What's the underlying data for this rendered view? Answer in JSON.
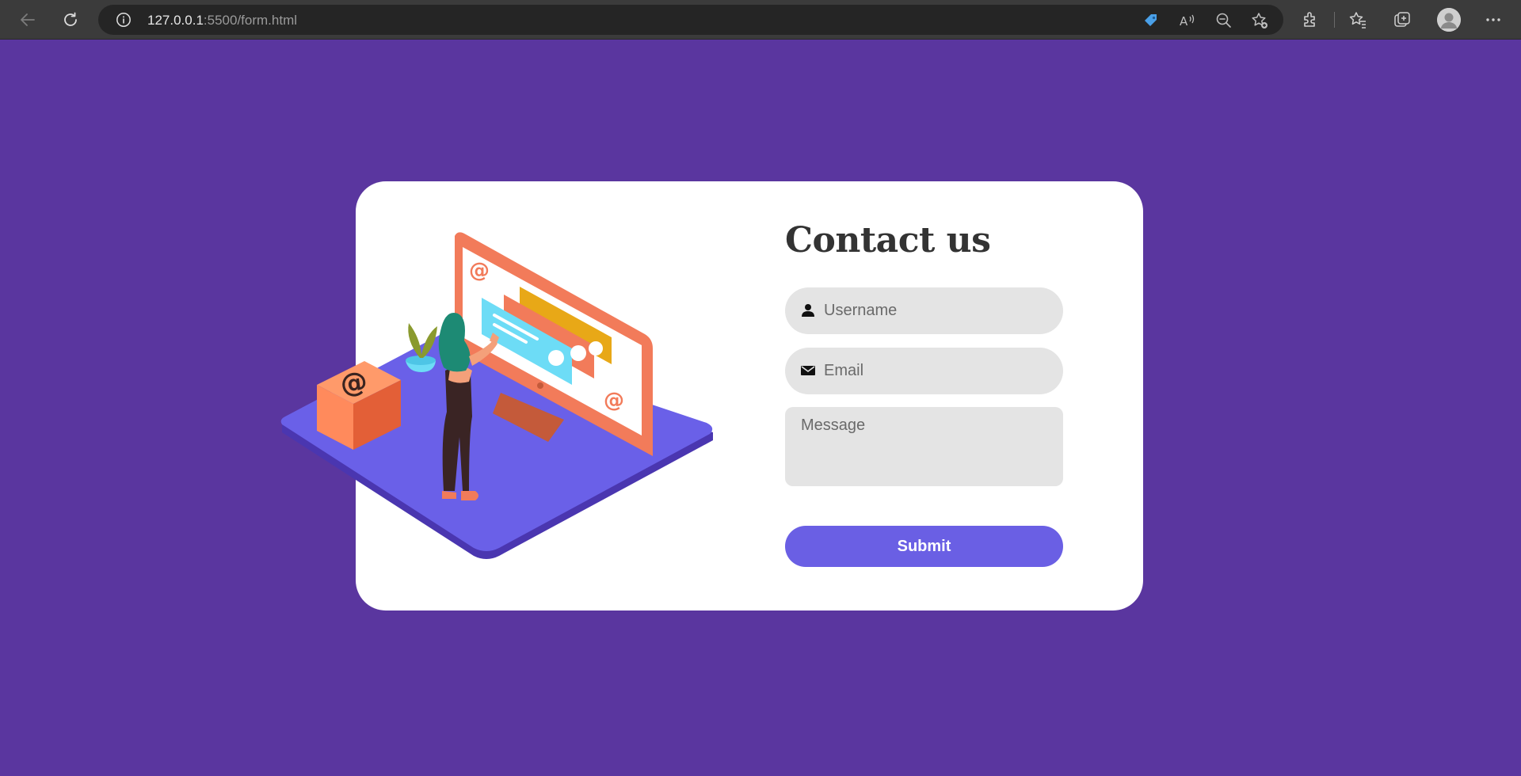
{
  "browser": {
    "url_host": "127.0.0.1",
    "url_rest": ":5500/form.html",
    "icons": [
      "back-icon",
      "reload-icon",
      "site-info-icon",
      "shopping-tag-icon",
      "read-aloud-icon",
      "zoom-out-icon",
      "add-favorite-icon",
      "extensions-icon",
      "favorites-icon",
      "collections-icon",
      "profile-avatar",
      "more-icon"
    ]
  },
  "contact": {
    "title": "Contact us",
    "username_placeholder": "Username",
    "email_placeholder": "Email",
    "message_placeholder": "Message",
    "submit_label": "Submit"
  },
  "colors": {
    "page_background": "#5a369f",
    "card_background": "#ffffff",
    "input_background": "#e4e4e4",
    "accent": "#6a5fe4",
    "title_text": "#333333"
  }
}
